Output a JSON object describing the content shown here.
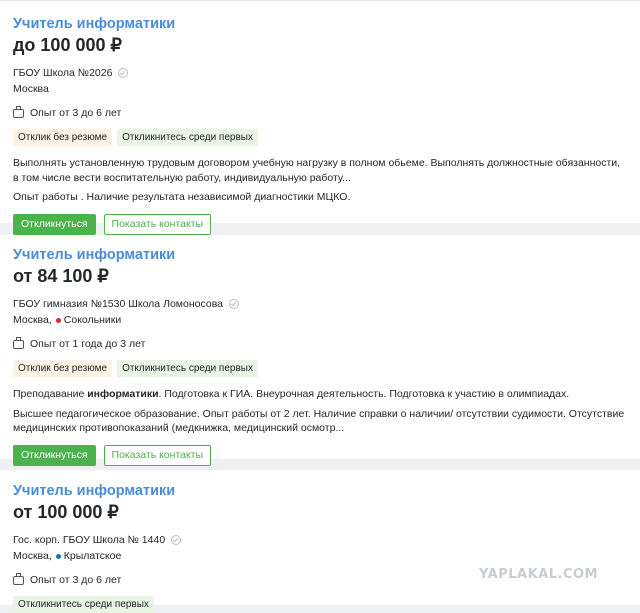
{
  "vacancies": [
    {
      "title": "Учитель информатики",
      "salary": "до 100 000 ₽",
      "employer": "ГБОУ Школа №2026",
      "city": "Москва",
      "metro": "",
      "metro_color": "",
      "experience": "Опыт от 3 до 6 лет",
      "tags": [
        "Отклик без резюме",
        "Откликнитесь среди первых"
      ],
      "desc_pre": "Выполнять установленную трудовым договором учебную нагрузку в полном обьеме. Выполнять должностные обязанности, в том числе вести воспитательную работу, индивидуальную работу...",
      "desc_bold": "",
      "desc_post": "",
      "requirements": "Опыт работы . Наличие результата независимой диагностики МЦКО.",
      "respond_label": "Откликнуться",
      "contacts_label": "Показать контакты"
    },
    {
      "title": "Учитель информатики",
      "salary": "от 84 100 ₽",
      "employer": "ГБОУ гимназия №1530 Школа Ломоносова",
      "city": "Москва,",
      "metro": "Сокольники",
      "metro_color": "#d9252a",
      "experience": "Опыт от 1 года до 3 лет",
      "tags": [
        "Отклик без резюме",
        "Откликнитесь среди первых"
      ],
      "desc_pre": "Преподавание ",
      "desc_bold": "информатики",
      "desc_post": ". Подготовка к ГИА. Внеурочная деятельность. Подготовка к участию в олимпиадах.",
      "requirements": "Высшее педагогическое образование. Опыт работы от 2 лет. Наличие справки о наличии/ отсутствии судимости. Отсутствие медицинских противопоказаний (медкнижка, медицинский осмотр...",
      "respond_label": "Откликнуться",
      "contacts_label": "Показать контакты"
    },
    {
      "title": "Учитель информатики",
      "salary": "от 100 000 ₽",
      "employer": "Гос. корп. ГБОУ Школа № 1440",
      "city": "Москва,",
      "metro": "Крылатское",
      "metro_color": "#1a6fb5",
      "experience": "Опыт от 3 до 6 лет",
      "tags": [
        "Откликнитесь среди первых"
      ]
    }
  ],
  "watermark": "YAPLAKAL.COM"
}
